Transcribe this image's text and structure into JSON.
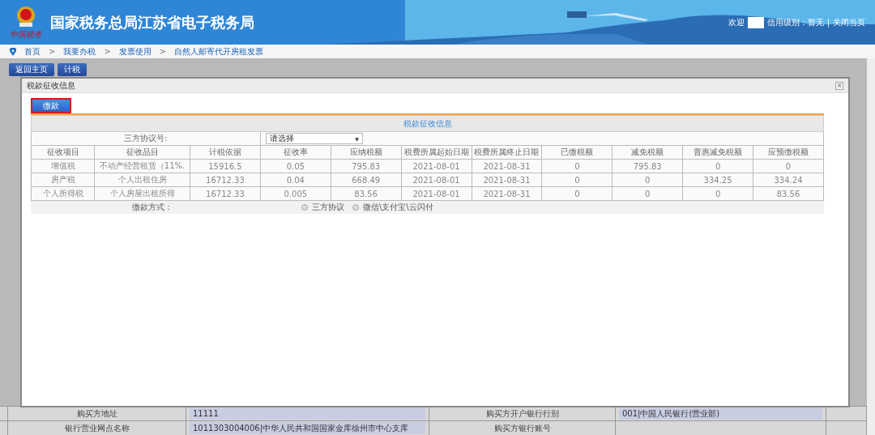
{
  "header": {
    "emblem_caption": "中国税务",
    "title": "国家税务总局江苏省电子税务局",
    "welcome": "欢迎",
    "credit": "信用级别：暂无",
    "separator": "|",
    "close_page": "关闭当页"
  },
  "breadcrumb": [
    "首页",
    "我要办税",
    "发票使用",
    "自然人邮寄代开房租发票"
  ],
  "breadcrumb_separator": ">",
  "toolbar": [
    "返回主页",
    "计税"
  ],
  "dialog": {
    "title": "税款征收信息",
    "close": "×",
    "tabs": [
      {
        "label": "缴款",
        "selected": true
      }
    ],
    "table_title": "税款征收信息",
    "agreement": {
      "label": "三方协议号:",
      "value": "请选择",
      "caret": "▼"
    },
    "columns": [
      "征收项目",
      "征收品目",
      "计税依据",
      "征收率",
      "应纳税额",
      "税费所属起始日期",
      "税费所属终止日期",
      "已缴税额",
      "减免税额",
      "普惠减免税额",
      "应预缴税额"
    ],
    "rows": [
      [
        "增值税",
        "不动产经营租赁（11%.",
        "15916.5",
        "0.05",
        "795.83",
        "2021-08-01",
        "2021-08-31",
        "0",
        "795.83",
        "0",
        "0"
      ],
      [
        "房产税",
        "个人出租住房",
        "16712.33",
        "0.04",
        "668.49",
        "2021-08-01",
        "2021-08-31",
        "0",
        "0",
        "334.25",
        "334.24"
      ],
      [
        "个人所得税",
        "个人房屋出租所得",
        "16712.33",
        "0.005",
        "83.56",
        "2021-08-01",
        "2021-08-31",
        "0",
        "0",
        "0",
        "83.56"
      ]
    ],
    "payment": {
      "label": "缴款方式：",
      "options": [
        {
          "label": "三方协议",
          "selected": false
        },
        {
          "label": "微信\\支付宝\\云闪付",
          "selected": false
        }
      ]
    }
  },
  "background_form": [
    {
      "label": "购买方地址",
      "value": "11111",
      "label_2": "购买方开户银行行别",
      "value_2": "001|中国人民银行(营业部)"
    },
    {
      "label": "银行营业网点名称",
      "value": "1011303004006|中华人民共和国国家金库徐州市中心支库",
      "label_2": "购买方银行账号"
    }
  ]
}
